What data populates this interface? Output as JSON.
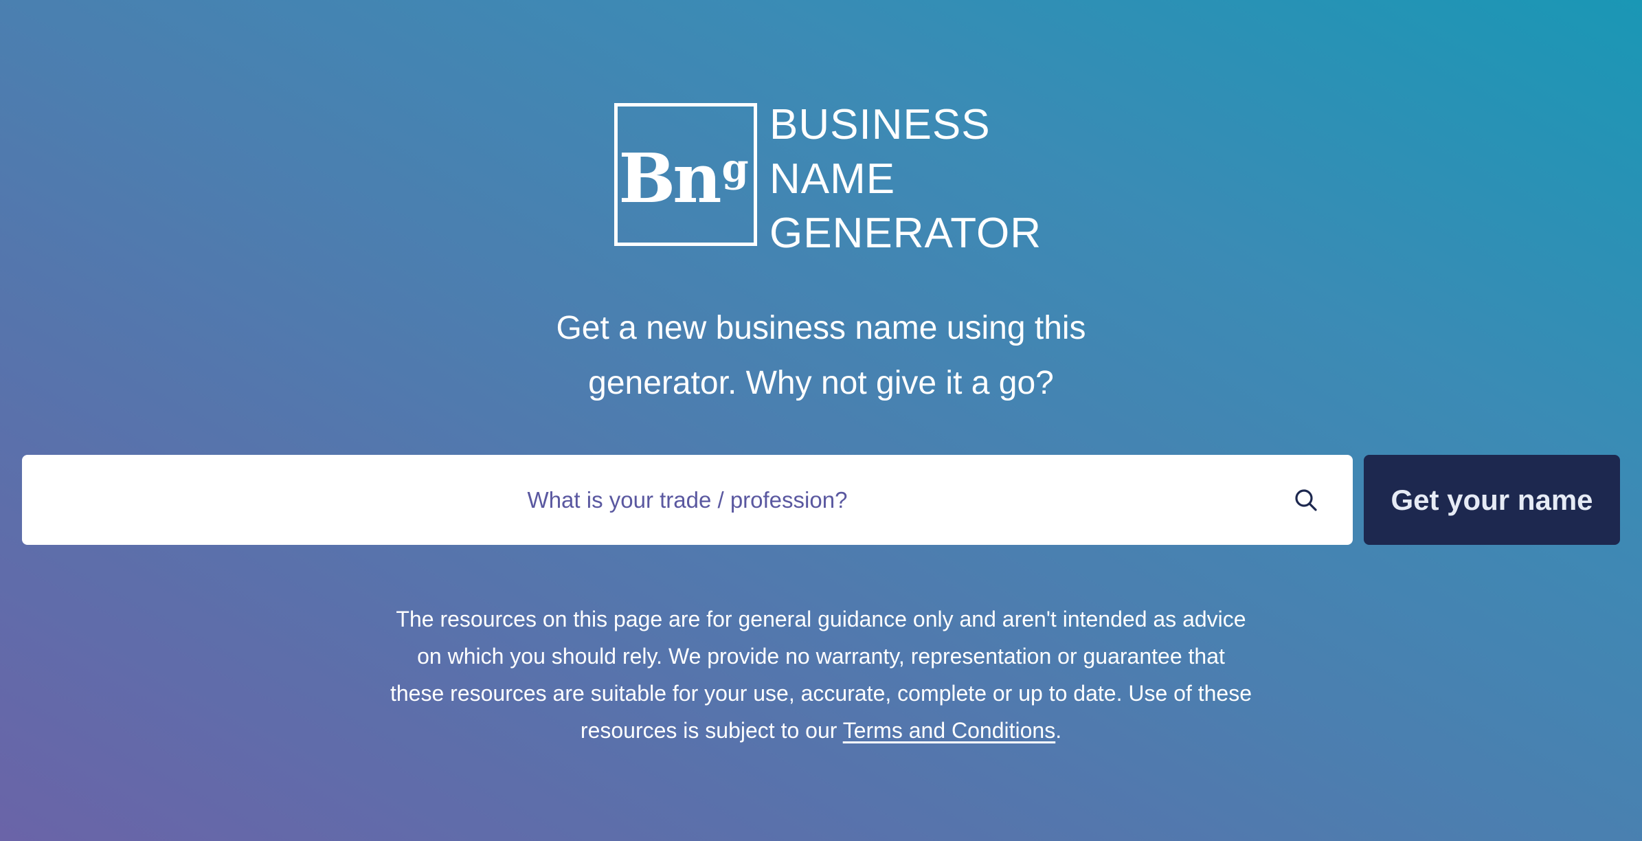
{
  "logo": {
    "mark": "Bn",
    "mark_sup": "g",
    "text_lines": [
      "BUSINESS",
      "NAME",
      "GENERATOR"
    ]
  },
  "tagline": {
    "lines": [
      "Get a new business name using this",
      "generator. Why not give it a go?"
    ]
  },
  "search": {
    "placeholder": "What is your trade / profession?",
    "value": "",
    "icon": "search-icon"
  },
  "cta": {
    "label": "Get your name"
  },
  "disclaimer": {
    "lines": [
      "The resources on this page are for general guidance only and aren't intended as advice",
      "on which you should rely. We provide no warranty, representation or guarantee that",
      "these resources are suitable for your use, accurate, complete or up to date. Use of these"
    ],
    "last_line_prefix": "resources is subject to our ",
    "link_text": "Terms and Conditions",
    "last_line_suffix": "."
  },
  "colors": {
    "background_start": "#6a64a8",
    "background_end": "#1a97b5",
    "button_bg": "#1d284f",
    "placeholder_text": "#5a58a0"
  }
}
